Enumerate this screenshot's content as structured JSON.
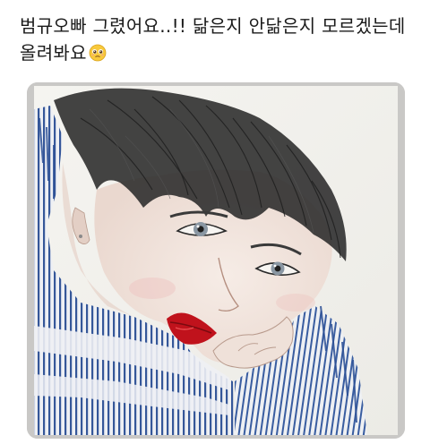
{
  "post": {
    "text_line1": "범규오빠 그렸어요..!! 닮은지 안닮은지 모르겠는데",
    "text_line2": "올려봐요",
    "emoji": "pleading-face-emoji"
  },
  "image": {
    "subject": "drawing"
  },
  "colors": {
    "text": "#1a1a1a",
    "background": "#ffffff",
    "paper": "#f4f2ee",
    "frame_shadow": "#c9c8c6",
    "sweater_blue": "#2b4f95",
    "lips_red": "#c0121c",
    "hair": "#2a2a2a"
  }
}
